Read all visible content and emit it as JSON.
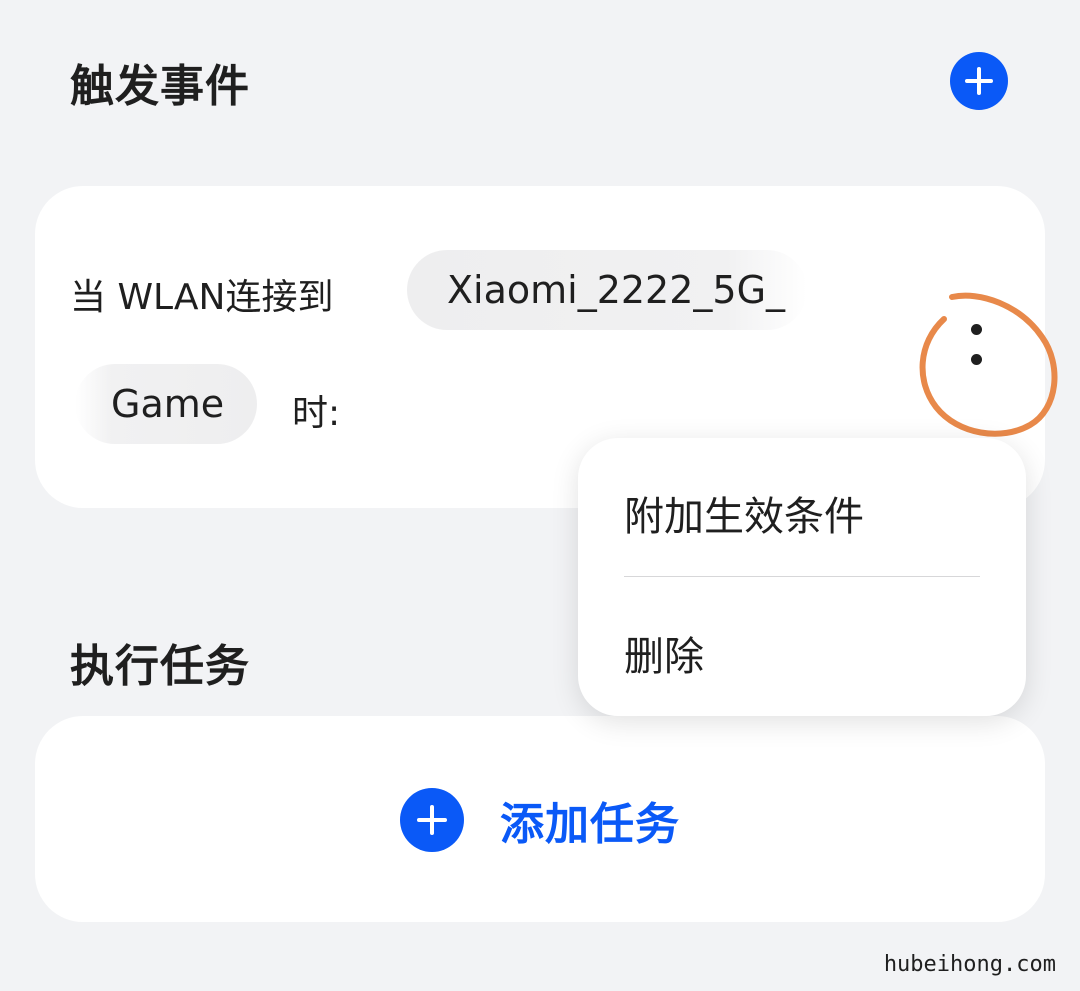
{
  "trigger_section": {
    "title": "触发事件",
    "add_icon": "plus-icon"
  },
  "trigger_card": {
    "prefix": "当 WLAN连接到",
    "network_name": "Xiaomi_2222_5G_",
    "network_name_cont": "Game",
    "suffix": "时:",
    "more_icon": "more-vertical-icon"
  },
  "context_menu": {
    "items": [
      {
        "label": "附加生效条件"
      },
      {
        "label": "删除"
      }
    ]
  },
  "task_section": {
    "title": "执行任务",
    "add_task_label": "添加任务",
    "add_icon": "plus-icon"
  },
  "watermark": "hubeihong.com",
  "colors": {
    "accent": "#0a59f7",
    "background": "#f2f3f5",
    "card": "#ffffff",
    "annotation": "#e8894a"
  }
}
